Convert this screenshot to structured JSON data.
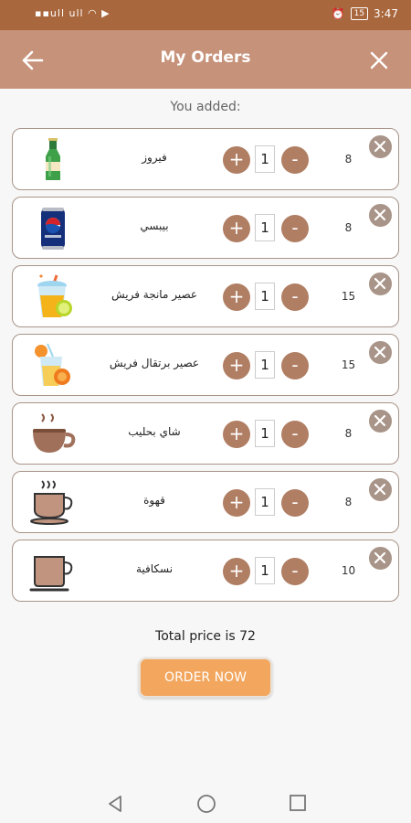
{
  "status_bar": {
    "left": "୅૯૯ ⫩ ⯁",
    "signal": "ull ull",
    "battery": "15",
    "time": "3:47"
  },
  "app_bar": {
    "title": "My Orders"
  },
  "section_label": "You added:",
  "items": [
    {
      "name": "فيروز",
      "qty": "1",
      "price": "8",
      "icon": "beer-bottle-icon"
    },
    {
      "name": "بيبسي",
      "qty": "1",
      "price": "8",
      "icon": "pepsi-can-icon"
    },
    {
      "name": "عصير مانجة فريش",
      "qty": "1",
      "price": "15",
      "icon": "mango-juice-icon"
    },
    {
      "name": "عصير برتقال فريش",
      "qty": "1",
      "price": "15",
      "icon": "orange-juice-icon"
    },
    {
      "name": "شاي بحليب",
      "qty": "1",
      "price": "8",
      "icon": "milk-tea-icon"
    },
    {
      "name": "قهوة",
      "qty": "1",
      "price": "8",
      "icon": "coffee-cup-icon"
    },
    {
      "name": "نسكافية",
      "qty": "1",
      "price": "10",
      "icon": "nescafe-mug-icon"
    }
  ],
  "buttons": {
    "plus": "+",
    "minus": "-"
  },
  "total_text": "Total price is 72",
  "order_button": "ORDER NOW",
  "colors": {
    "status_bar": "#a9673d",
    "app_bar": "#c7927a",
    "qty_button": "#b07e63",
    "remove_button": "#a89488",
    "order_button": "#f2a65e"
  }
}
